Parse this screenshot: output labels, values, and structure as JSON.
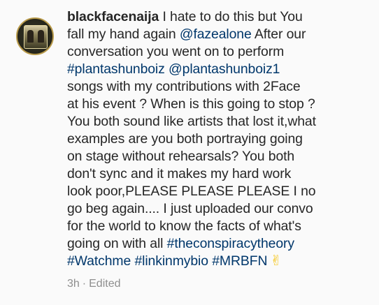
{
  "comment": {
    "username": "blackfacenaija",
    "lines": [
      [
        {
          "t": "username",
          "v": "blackfacenaija"
        },
        {
          "t": "text",
          "v": " I hate to do this but You"
        }
      ],
      [
        {
          "t": "text",
          "v": "fall my hand again "
        },
        {
          "t": "link",
          "v": "@fazealone"
        },
        {
          "t": "text",
          "v": " After our"
        }
      ],
      [
        {
          "t": "text",
          "v": "conversation you went on to perform"
        }
      ],
      [
        {
          "t": "link",
          "v": "#plantashunboiz"
        },
        {
          "t": "text",
          "v": "  "
        },
        {
          "t": "link",
          "v": "@plantashunboiz1"
        }
      ],
      [
        {
          "t": "text",
          "v": "songs with my contributions with 2Face"
        }
      ],
      [
        {
          "t": "text",
          "v": "at his event ? When is this going to stop ?"
        }
      ],
      [
        {
          "t": "text",
          "v": "You both sound like artists that lost it,what"
        }
      ],
      [
        {
          "t": "text",
          "v": "examples are you both portraying going"
        }
      ],
      [
        {
          "t": "text",
          "v": "on stage without rehearsals? You both"
        }
      ],
      [
        {
          "t": "text",
          "v": "don't sync and it makes my  hard work"
        }
      ],
      [
        {
          "t": "text",
          "v": "look poor,PLEASE PLEASE PLEASE I no"
        }
      ],
      [
        {
          "t": "text",
          "v": "go beg again.... I just uploaded our convo"
        }
      ],
      [
        {
          "t": "text",
          "v": "for the world to know the facts of what's"
        }
      ],
      [
        {
          "t": "text",
          "v": "going on with all "
        },
        {
          "t": "link",
          "v": "#theconspiracytheory"
        }
      ],
      [
        {
          "t": "link",
          "v": "#Watchme"
        },
        {
          "t": "text",
          "v": " "
        },
        {
          "t": "link",
          "v": "#linkinmybio"
        },
        {
          "t": "text",
          "v": " "
        },
        {
          "t": "link",
          "v": "#MRBFN"
        },
        {
          "t": "icon",
          "v": "victory-hand-icon"
        }
      ]
    ],
    "time": "3h",
    "separator": "·",
    "edited_label": "Edited"
  },
  "icons": {
    "victory-hand-icon": "✌"
  },
  "colors": {
    "text": "#262626",
    "link": "#00376b",
    "meta": "#8e8e8e",
    "background": "#fafafa"
  }
}
